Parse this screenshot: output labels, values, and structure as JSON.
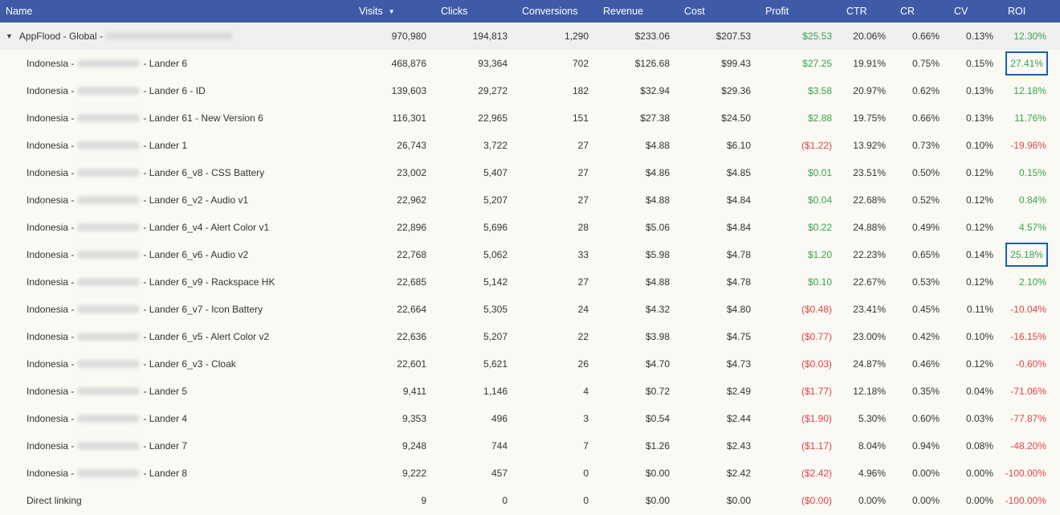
{
  "columns": {
    "name": "Name",
    "visits": "Visits",
    "clicks": "Clicks",
    "conversions": "Conversions",
    "revenue": "Revenue",
    "cost": "Cost",
    "profit": "Profit",
    "ctr": "CTR",
    "cr": "CR",
    "cv": "CV",
    "roi": "ROI"
  },
  "sort_icon": "sort-descending-icon",
  "colors": {
    "header_bg": "#3f5ba7",
    "positive": "#3aa34a",
    "negative": "#e0444a",
    "highlight": "#1a5fb4"
  },
  "group": {
    "prefix": "AppFlood - Global -",
    "visits": "970,980",
    "clicks": "194,813",
    "conversions": "1,290",
    "revenue": "$233.06",
    "cost": "$207.53",
    "profit": "$25.53",
    "ctr": "20.06%",
    "cr": "0.66%",
    "cv": "0.13%",
    "roi": "12.30%"
  },
  "rows": [
    {
      "prefix": "Indonesia -",
      "suffix": "- Lander 6",
      "visits": "468,876",
      "clicks": "93,364",
      "conversions": "702",
      "revenue": "$126.68",
      "cost": "$99.43",
      "profit": "$27.25",
      "ctr": "19.91%",
      "cr": "0.75%",
      "cv": "0.15%",
      "roi": "27.41%"
    },
    {
      "prefix": "Indonesia -",
      "suffix": "- Lander 6 - ID",
      "visits": "139,603",
      "clicks": "29,272",
      "conversions": "182",
      "revenue": "$32.94",
      "cost": "$29.36",
      "profit": "$3.58",
      "ctr": "20.97%",
      "cr": "0.62%",
      "cv": "0.13%",
      "roi": "12.18%"
    },
    {
      "prefix": "Indonesia -",
      "suffix": "- Lander 61 - New Version 6",
      "visits": "116,301",
      "clicks": "22,965",
      "conversions": "151",
      "revenue": "$27.38",
      "cost": "$24.50",
      "profit": "$2.88",
      "ctr": "19.75%",
      "cr": "0.66%",
      "cv": "0.13%",
      "roi": "11.76%"
    },
    {
      "prefix": "Indonesia -",
      "suffix": "- Lander 1",
      "visits": "26,743",
      "clicks": "3,722",
      "conversions": "27",
      "revenue": "$4.88",
      "cost": "$6.10",
      "profit": "($1.22)",
      "ctr": "13.92%",
      "cr": "0.73%",
      "cv": "0.10%",
      "roi": "-19.96%"
    },
    {
      "prefix": "Indonesia -",
      "suffix": "- Lander 6_v8 - CSS Battery",
      "visits": "23,002",
      "clicks": "5,407",
      "conversions": "27",
      "revenue": "$4.86",
      "cost": "$4.85",
      "profit": "$0.01",
      "ctr": "23.51%",
      "cr": "0.50%",
      "cv": "0.12%",
      "roi": "0.15%"
    },
    {
      "prefix": "Indonesia -",
      "suffix": "- Lander 6_v2 - Audio v1",
      "visits": "22,962",
      "clicks": "5,207",
      "conversions": "27",
      "revenue": "$4.88",
      "cost": "$4.84",
      "profit": "$0.04",
      "ctr": "22.68%",
      "cr": "0.52%",
      "cv": "0.12%",
      "roi": "0.84%"
    },
    {
      "prefix": "Indonesia -",
      "suffix": "- Lander 6_v4 - Alert Color v1",
      "visits": "22,896",
      "clicks": "5,696",
      "conversions": "28",
      "revenue": "$5.06",
      "cost": "$4.84",
      "profit": "$0.22",
      "ctr": "24.88%",
      "cr": "0.49%",
      "cv": "0.12%",
      "roi": "4.57%"
    },
    {
      "prefix": "Indonesia -",
      "suffix": "- Lander 6_v6 - Audio v2",
      "visits": "22,768",
      "clicks": "5,062",
      "conversions": "33",
      "revenue": "$5.98",
      "cost": "$4.78",
      "profit": "$1.20",
      "ctr": "22.23%",
      "cr": "0.65%",
      "cv": "0.14%",
      "roi": "25.18%"
    },
    {
      "prefix": "Indonesia -",
      "suffix": "- Lander 6_v9 - Rackspace HK",
      "visits": "22,685",
      "clicks": "5,142",
      "conversions": "27",
      "revenue": "$4.88",
      "cost": "$4.78",
      "profit": "$0.10",
      "ctr": "22.67%",
      "cr": "0.53%",
      "cv": "0.12%",
      "roi": "2.10%"
    },
    {
      "prefix": "Indonesia -",
      "suffix": "- Lander 6_v7 - Icon Battery",
      "visits": "22,664",
      "clicks": "5,305",
      "conversions": "24",
      "revenue": "$4.32",
      "cost": "$4.80",
      "profit": "($0.48)",
      "ctr": "23.41%",
      "cr": "0.45%",
      "cv": "0.11%",
      "roi": "-10.04%"
    },
    {
      "prefix": "Indonesia -",
      "suffix": "- Lander 6_v5 - Alert Color v2",
      "visits": "22,636",
      "clicks": "5,207",
      "conversions": "22",
      "revenue": "$3.98",
      "cost": "$4.75",
      "profit": "($0.77)",
      "ctr": "23.00%",
      "cr": "0.42%",
      "cv": "0.10%",
      "roi": "-16.15%"
    },
    {
      "prefix": "Indonesia -",
      "suffix": "- Lander 6_v3 - Cloak",
      "visits": "22,601",
      "clicks": "5,621",
      "conversions": "26",
      "revenue": "$4.70",
      "cost": "$4.73",
      "profit": "($0.03)",
      "ctr": "24.87%",
      "cr": "0.46%",
      "cv": "0.12%",
      "roi": "-0.60%"
    },
    {
      "prefix": "Indonesia -",
      "suffix": "- Lander 5",
      "visits": "9,411",
      "clicks": "1,146",
      "conversions": "4",
      "revenue": "$0.72",
      "cost": "$2.49",
      "profit": "($1.77)",
      "ctr": "12.18%",
      "cr": "0.35%",
      "cv": "0.04%",
      "roi": "-71.06%"
    },
    {
      "prefix": "Indonesia -",
      "suffix": "- Lander 4",
      "visits": "9,353",
      "clicks": "496",
      "conversions": "3",
      "revenue": "$0.54",
      "cost": "$2.44",
      "profit": "($1.90)",
      "ctr": "5.30%",
      "cr": "0.60%",
      "cv": "0.03%",
      "roi": "-77.87%"
    },
    {
      "prefix": "Indonesia -",
      "suffix": "- Lander 7",
      "visits": "9,248",
      "clicks": "744",
      "conversions": "7",
      "revenue": "$1.26",
      "cost": "$2.43",
      "profit": "($1.17)",
      "ctr": "8.04%",
      "cr": "0.94%",
      "cv": "0.08%",
      "roi": "-48.20%"
    },
    {
      "prefix": "Indonesia -",
      "suffix": "- Lander 8",
      "visits": "9,222",
      "clicks": "457",
      "conversions": "0",
      "revenue": "$0.00",
      "cost": "$2.42",
      "profit": "($2.42)",
      "ctr": "4.96%",
      "cr": "0.00%",
      "cv": "0.00%",
      "roi": "-100.00%"
    },
    {
      "prefix": "Direct linking",
      "suffix": "",
      "visits": "9",
      "clicks": "0",
      "conversions": "0",
      "revenue": "$0.00",
      "cost": "$0.00",
      "profit": "($0.00)",
      "ctr": "0.00%",
      "cr": "0.00%",
      "cv": "0.00%",
      "roi": "-100.00%"
    }
  ]
}
